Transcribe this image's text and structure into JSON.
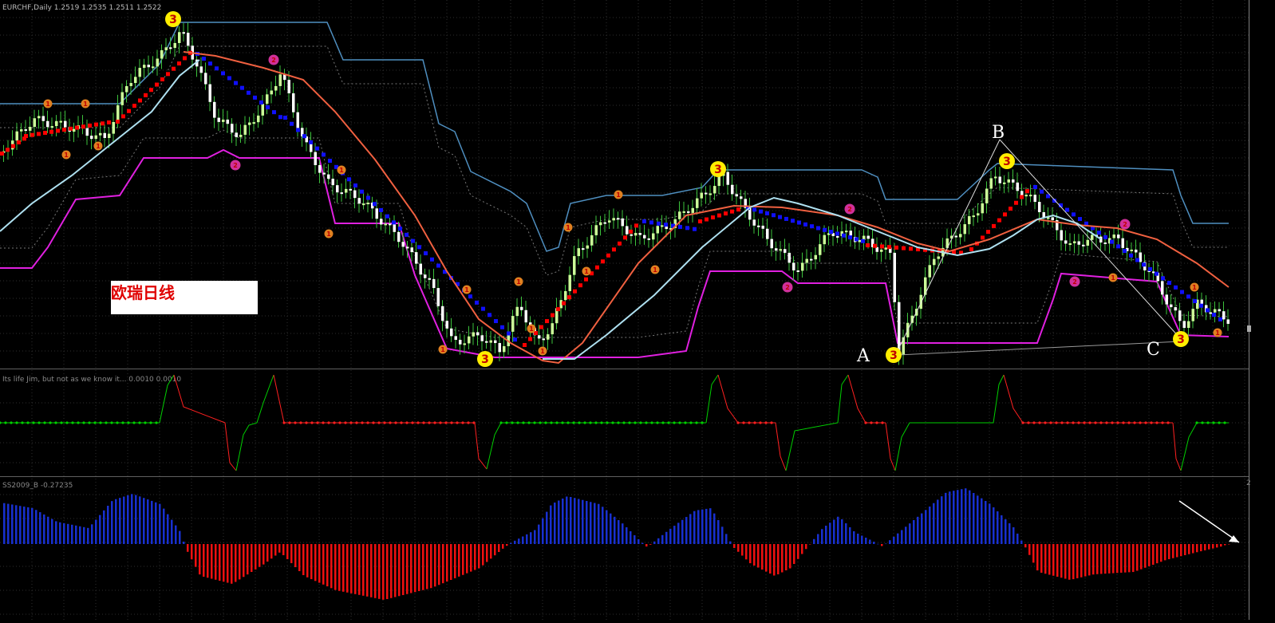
{
  "header": {
    "symbol_info": "EURCHF,Daily  1.2519 1.2535 1.2511 1.2522"
  },
  "panels": {
    "ind1_label": "Its life Jim, but not as we know it...  0.0010 0.0010",
    "ind2_label": "SS2009_B -0.27235",
    "right_scale_top": "2"
  },
  "annotations": {
    "chinese_label": "欧瑞日线",
    "point_a": "A",
    "point_b": "B",
    "point_c": "C",
    "wave_marker": "3",
    "small_marker": "1",
    "pink_marker": "2"
  },
  "colors": {
    "background": "#000000",
    "grid": "#333333",
    "bull_candle": "#ccff99",
    "bear_candle": "#ffffff",
    "upper_band": "#4f8fc0",
    "lower_band": "#e020e0",
    "fast_ma": "#f06040",
    "slow_ma": "#aee0f0",
    "trend_red": "#ff0000",
    "trend_blue": "#1010ff",
    "osc_green": "#00d000",
    "osc_red": "#ff2020",
    "hist_blue": "#1830d0",
    "hist_red": "#f01010",
    "marker_yellow": "#ffee00",
    "marker_orange": "#e08020",
    "marker_pink": "#d0309a"
  }
}
